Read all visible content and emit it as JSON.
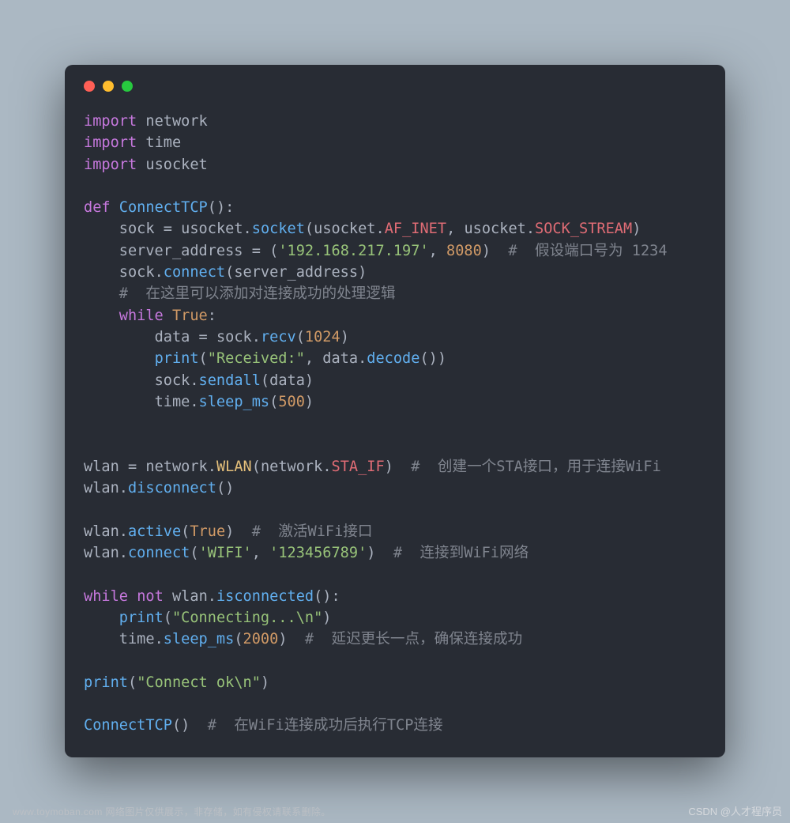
{
  "code": {
    "imports": [
      {
        "kw": "import",
        "mod": "network"
      },
      {
        "kw": "import",
        "mod": "time"
      },
      {
        "kw": "import",
        "mod": "usocket"
      }
    ],
    "func": {
      "def_kw": "def",
      "name": "ConnectTCP",
      "body": {
        "l1": {
          "var": "sock",
          "eq": "=",
          "mod": "usocket",
          "meth": "socket",
          "argmod": "usocket",
          "c1": "AF_INET",
          "c2": "SOCK_STREAM"
        },
        "l2": {
          "var": "server_address",
          "eq": "=",
          "ip": "'192.168.217.197'",
          "port": "8080",
          "comment": "#  假设端口号为 1234"
        },
        "l3": {
          "obj": "sock",
          "meth": "connect",
          "arg": "server_address"
        },
        "l4": {
          "comment": "#  在这里可以添加对连接成功的处理逻辑"
        },
        "l5": {
          "kw": "while",
          "cond": "True"
        },
        "l6": {
          "var": "data",
          "eq": "=",
          "obj": "sock",
          "meth": "recv",
          "arg": "1024"
        },
        "l7": {
          "fn": "print",
          "s": "\"Received:\"",
          "obj": "data",
          "meth": "decode"
        },
        "l8": {
          "obj": "sock",
          "meth": "sendall",
          "arg": "data"
        },
        "l9": {
          "obj": "time",
          "meth": "sleep_ms",
          "arg": "500"
        }
      }
    },
    "main": {
      "m1": {
        "var": "wlan",
        "eq": "=",
        "mod": "network",
        "cls": "WLAN",
        "argmod": "network",
        "argc": "STA_IF",
        "comment": "#  创建一个STA接口，用于连接WiFi"
      },
      "m2": {
        "obj": "wlan",
        "meth": "disconnect"
      },
      "m3": {
        "obj": "wlan",
        "meth": "active",
        "arg": "True",
        "comment": "#  激活WiFi接口"
      },
      "m4": {
        "obj": "wlan",
        "meth": "connect",
        "a1": "'WIFI'",
        "a2": "'123456789'",
        "comment": "#  连接到WiFi网络"
      },
      "m5": {
        "kw1": "while",
        "kw2": "not",
        "obj": "wlan",
        "meth": "isconnected"
      },
      "m6": {
        "fn": "print",
        "s": "\"Connecting...\\n\""
      },
      "m7": {
        "obj": "time",
        "meth": "sleep_ms",
        "arg": "2000",
        "comment": "#  延迟更长一点，确保连接成功"
      },
      "m8": {
        "fn": "print",
        "s": "\"Connect ok\\n\""
      },
      "m9": {
        "fn": "ConnectTCP",
        "comment": "#  在WiFi连接成功后执行TCP连接"
      }
    }
  },
  "footer": {
    "left": "www.toymoban.com 网络图片仅供展示，非存储，如有侵权请联系删除。",
    "right": "CSDN @人才程序员"
  }
}
